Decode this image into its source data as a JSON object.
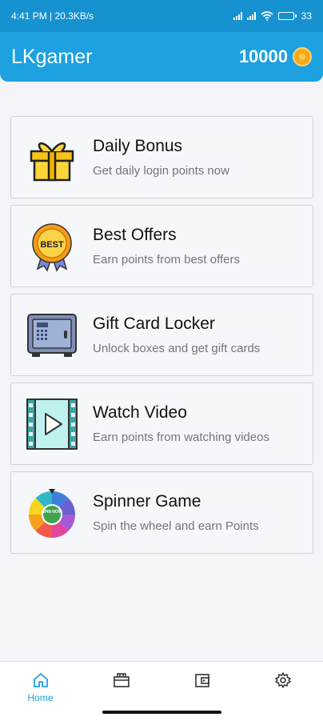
{
  "status": {
    "time_speed": "4:41 PM | 20.3KB/s",
    "battery": "33",
    "battery_level": 0.33
  },
  "app": {
    "title": "LKgamer",
    "points": "10000"
  },
  "cards": [
    {
      "title": "Daily Bonus",
      "subtitle": "Get daily login points now",
      "icon": "gift-icon"
    },
    {
      "title": "Best Offers",
      "subtitle": "Earn points from best offers",
      "icon": "best-medal-icon",
      "badge": "BEST"
    },
    {
      "title": "Gift Card Locker",
      "subtitle": "Unlock boxes and get gift cards",
      "icon": "safe-icon"
    },
    {
      "title": "Watch Video",
      "subtitle": "Earn points from watching videos",
      "icon": "video-play-icon"
    },
    {
      "title": "Spinner Game",
      "subtitle": "Spin the wheel and earn Points",
      "icon": "spin-wheel-icon",
      "badge": "SPIN NOW"
    }
  ],
  "nav": {
    "home_label": "Home",
    "items": [
      "home-icon",
      "gift-card-icon",
      "wallet-icon",
      "settings-icon"
    ]
  },
  "colors": {
    "primary": "#1da1e0",
    "statusbar": "#1592cf",
    "background": "#f3f5f9"
  }
}
